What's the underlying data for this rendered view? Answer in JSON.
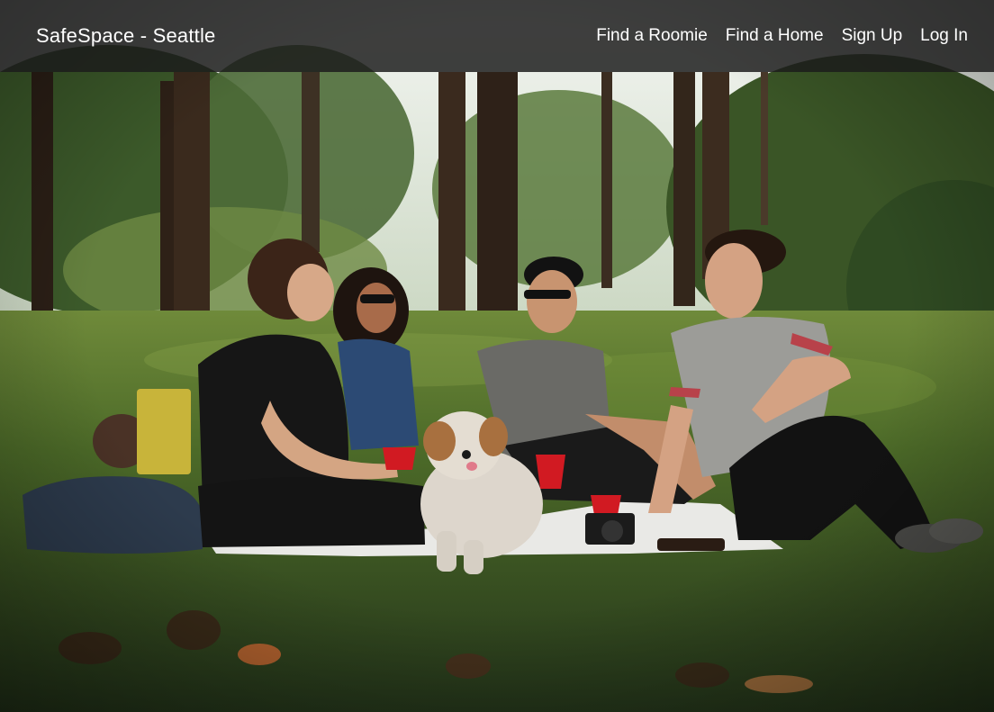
{
  "navbar": {
    "brand": "SafeSpace - Seattle",
    "links": [
      {
        "label": "Find a Roomie"
      },
      {
        "label": "Find a Home"
      },
      {
        "label": "Sign Up"
      },
      {
        "label": "Log In"
      }
    ]
  },
  "hero": {
    "image_subject": "friends-picnic-with-dog-photo"
  },
  "colors": {
    "navbar_bg": "#1c1c1c",
    "nav_text": "#ffffff",
    "grass": "#3f5f24",
    "sky": "#eef2f0",
    "blanket": "#f1f1f1",
    "red_cup": "#d11a22"
  }
}
